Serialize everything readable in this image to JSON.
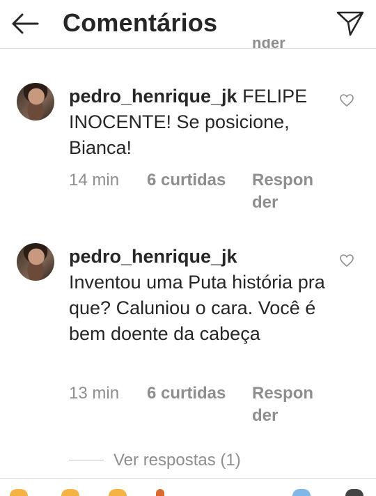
{
  "header": {
    "title": "Comentários"
  },
  "ghost_text": "nder",
  "comments": [
    {
      "username": "pedro_henrique_jk",
      "text": "FELIPE INOCENTE! Se posicione, Bianca!",
      "time": "14 min",
      "likes": "6 curtidas",
      "reply": "Responder"
    },
    {
      "username": "pedro_henrique_jk",
      "text": "Inventou uma Puta história pra que? Caluniou o cara. Você é bem doente da cabeça",
      "time": "13 min",
      "likes": "6 curtidas",
      "reply": "Responder"
    }
  ],
  "view_replies": "Ver respostas (1)"
}
